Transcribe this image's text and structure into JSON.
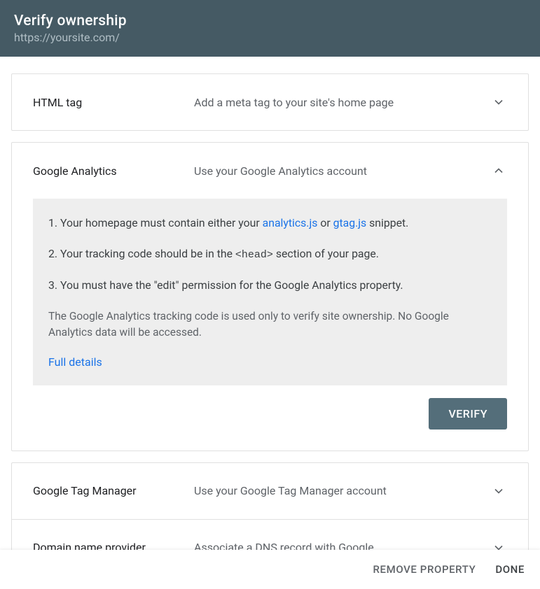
{
  "header": {
    "title": "Verify ownership",
    "url": "https://yoursite.com/"
  },
  "methods": {
    "html_tag": {
      "title": "HTML tag",
      "desc": "Add a meta tag to your site's home page"
    },
    "google_analytics": {
      "title": "Google Analytics",
      "desc": "Use your Google Analytics account",
      "step1_a": "1. Your homepage must contain either your ",
      "step1_link1": "analytics.js",
      "step1_b": " or ",
      "step1_link2": "gtag.js",
      "step1_c": " snippet.",
      "step2_a": "2. Your tracking code should be in the ",
      "step2_code": "<head>",
      "step2_b": " section of your page.",
      "step3": "3. You must have the \"edit\" permission for the Google Analytics property.",
      "note": "The Google Analytics tracking code is used only to verify site ownership. No Google Analytics data will be accessed.",
      "details_link": "Full details",
      "verify_label": "VERIFY"
    },
    "tag_manager": {
      "title": "Google Tag Manager",
      "desc": "Use your Google Tag Manager account"
    },
    "dns": {
      "title": "Domain name provider",
      "desc": "Associate a DNS record with Google"
    }
  },
  "footer": {
    "remove": "REMOVE PROPERTY",
    "done": "DONE"
  }
}
